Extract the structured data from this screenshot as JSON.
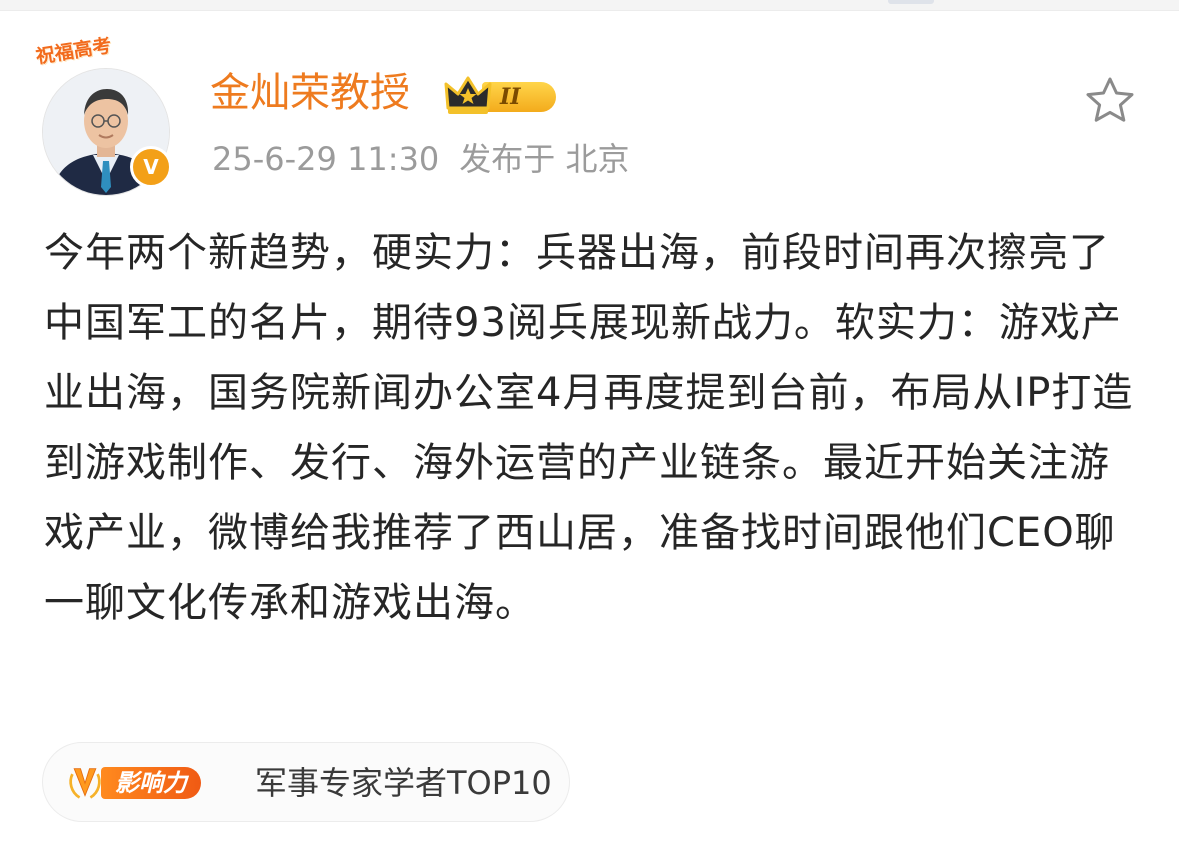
{
  "post": {
    "blessing_badge": "祝福高考",
    "author_name": "金灿荣教授",
    "level_badge": "II",
    "verified_mark": "V",
    "date": "25-6-29 11:30",
    "location": "发布于 北京",
    "body": "今年两个新趋势，硬实力：兵器出海，前段时间再次擦亮了中国军工的名片，期待93阅兵展现新战力。软实力：游戏产业出海，国务院新闻办公室4月再度提到台前，布局从IP打造到游戏制作、发行、海外运营的产业链条。最近开始关注游戏产业，微博给我推荐了西山居，准备找时间跟他们CEO聊一聊文化传承和游戏出海。"
  },
  "influence": {
    "label": "影响力",
    "text": "军事专家学者TOP10"
  },
  "icons": {
    "favorite": "star-outline-icon",
    "crown": "crown-icon",
    "influence": "v-laurel-icon"
  },
  "colors": {
    "name": "#ee7b1f",
    "meta": "#9b9b9b",
    "body": "#262626",
    "badge": "#f3a018"
  }
}
